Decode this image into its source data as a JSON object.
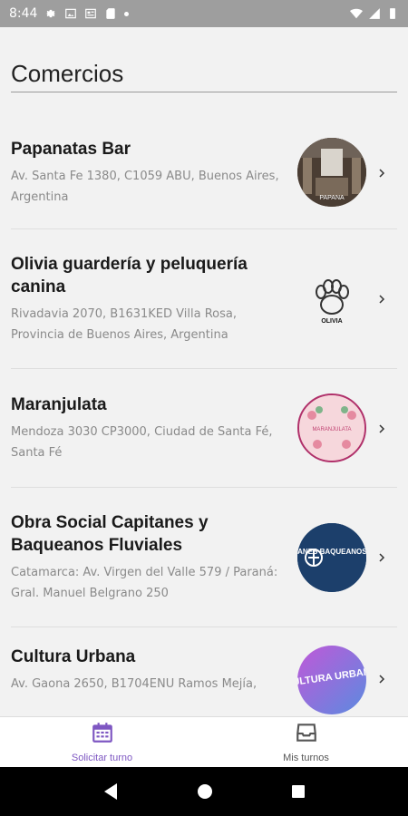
{
  "status_bar": {
    "time": "8:44"
  },
  "header": {
    "title": "Comercios"
  },
  "businesses": [
    {
      "name": "Papanatas Bar",
      "address": "Av. Santa Fe 1380, C1059 ABU, Buenos Aires, Argentina",
      "logo_text": "PAPANA"
    },
    {
      "name": "Olivia guardería y peluquería canina",
      "address": "Rivadavia 2070, B1631KED Villa Rosa, Provincia de Buenos Aires, Argentina",
      "logo_text": "OLIVIA"
    },
    {
      "name": "Maranjulata",
      "address": "Mendoza 3030 CP3000, Ciudad de Santa Fé, Santa Fé",
      "logo_text": "MARANJULATA"
    },
    {
      "name": "Obra Social Capitanes y Baqueanos Fluviales",
      "address": "Catamarca: Av. Virgen del Valle 579 / Paraná: Gral. Manuel Belgrano 250",
      "logo_text": "CAPITANES BAQUEANOS FLUVIALES"
    },
    {
      "name": "Cultura Urbana",
      "address": "Av. Gaona 2650, B1704ENU Ramos Mejía,",
      "logo_text": "CULTURA URBANA"
    }
  ],
  "bottom_nav": {
    "tabs": [
      {
        "label": "Solicitar turno",
        "icon": "calendar-icon",
        "active": true
      },
      {
        "label": "Mis turnos",
        "icon": "inbox-icon",
        "active": false
      }
    ]
  },
  "colors": {
    "accent": "#7e57c2",
    "status_bar": "#9e9e9e",
    "background": "#f2f2f2"
  }
}
